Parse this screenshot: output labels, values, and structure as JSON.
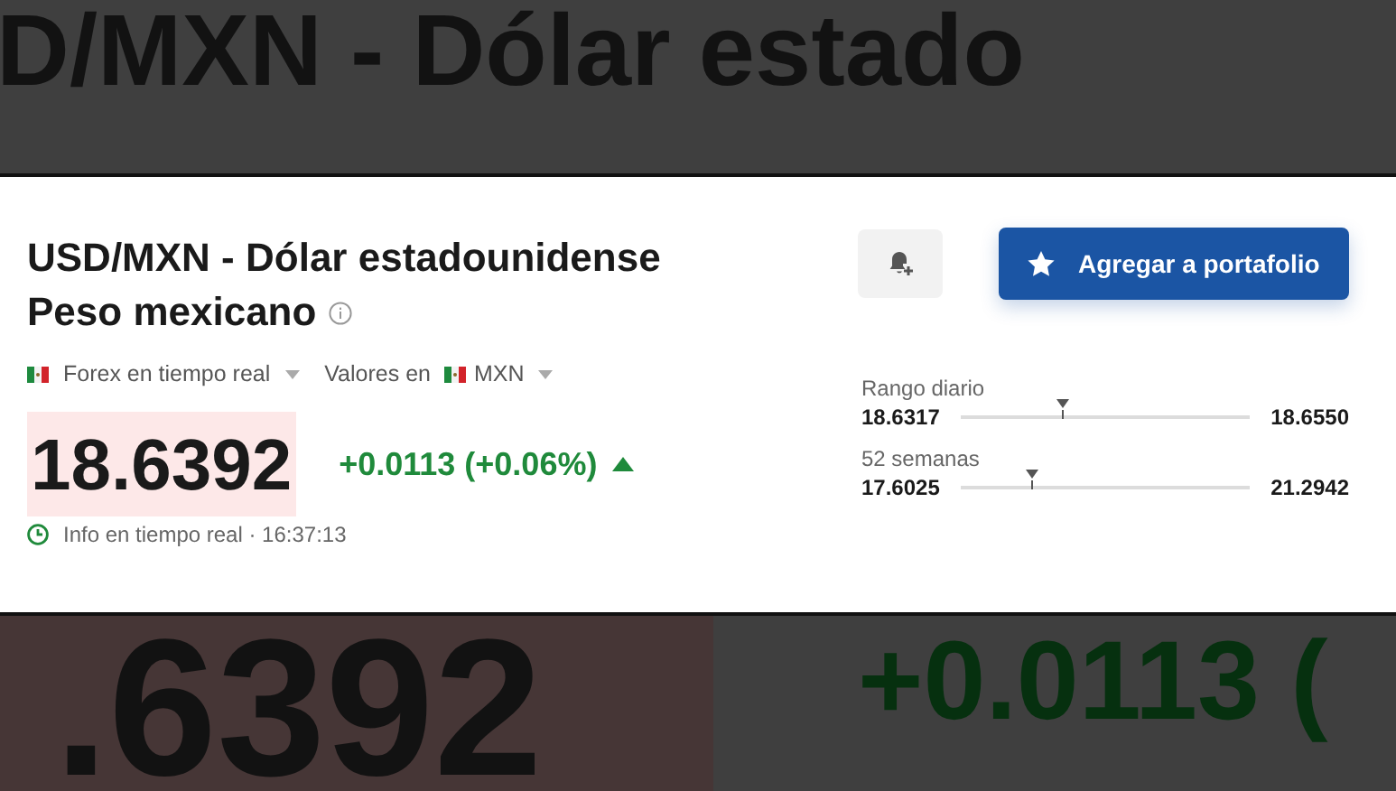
{
  "backdrop": {
    "top_text": "D/MXN - Dólar estado",
    "bottom_price": ".6392",
    "bottom_change": "+0.0113 ("
  },
  "header": {
    "title_line_1": "USD/MXN - Dólar estadounidense",
    "title_line_2": "Peso mexicano"
  },
  "meta": {
    "source": "Forex en tiempo real",
    "currency_prefix": "Valores en",
    "currency": "MXN"
  },
  "add_button": "Agregar a portafolio",
  "quote": {
    "price": "18.6392",
    "change": "+0.0113 (+0.06%)",
    "rising": true,
    "status": "Info en tiempo real · 16:37:13"
  },
  "ranges": [
    {
      "label": "Rango diario",
      "low": "18.6317",
      "high": "18.6550",
      "level": 0.35
    },
    {
      "label": "52 semanas",
      "low": "17.6025",
      "high": "21.2942",
      "level": 0.24
    }
  ]
}
